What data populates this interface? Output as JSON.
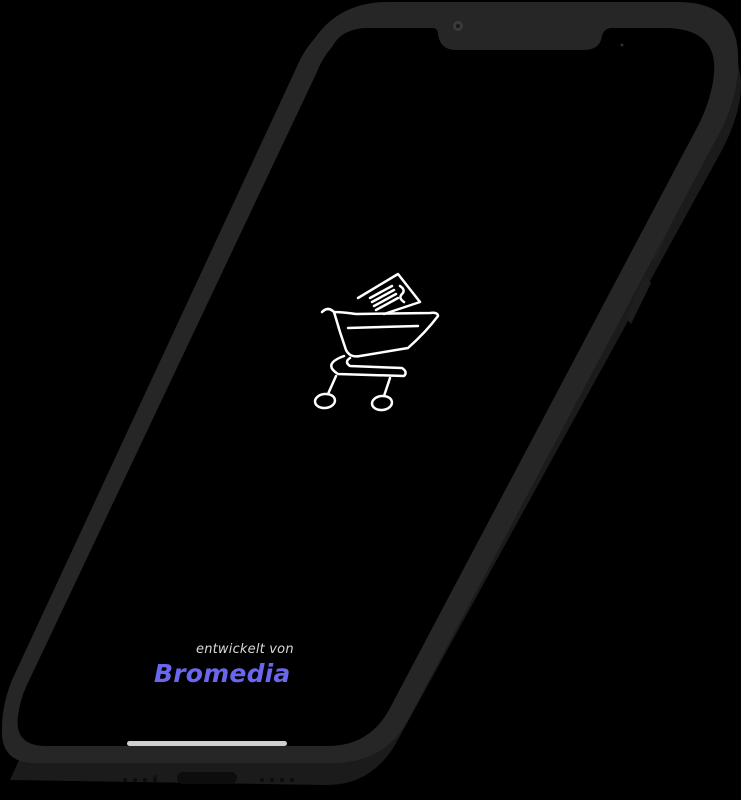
{
  "splash": {
    "logo_icon": "shopping-cart-with-receipt-icon",
    "credit_text": "entwickelt von",
    "brand_name": "Bromedia"
  },
  "colors": {
    "brand": "#6b66f0",
    "device_frame": "#262626",
    "screen": "#000000",
    "logo_stroke": "#ffffff"
  }
}
